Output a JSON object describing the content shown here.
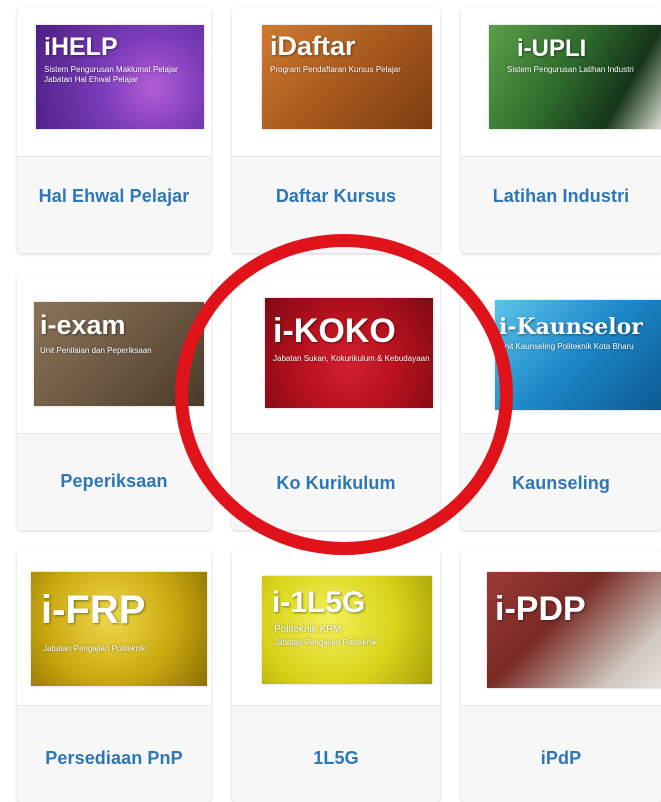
{
  "tiles": [
    {
      "label": "Hal Ehwal Pelajar",
      "banner_title": "iHELP",
      "banner_sub": "Sistem Pengurusan Maklumat Pelajar",
      "banner_sub2": "Jabatan Hal Ehwal Pelajar"
    },
    {
      "label": "Daftar Kursus",
      "banner_title": "iDaftar",
      "banner_sub": "Program Pendaftaran Kursus Pelajar",
      "banner_sub2": ""
    },
    {
      "label": "Latihan Industri",
      "banner_title": "i-UPLI",
      "banner_sub": "Sistem Pengurusan Latihan Industri",
      "banner_sub2": ""
    },
    {
      "label": "Peperiksaan",
      "banner_title": "i-exam",
      "banner_sub": "Unit Penilaian dan Peperiksaan",
      "banner_sub2": ""
    },
    {
      "label": "Ko Kurikulum",
      "banner_title": "i-KOKO",
      "banner_sub": "Jabatan Sukan, Kokurikulum & Kebudayaan",
      "banner_sub2": ""
    },
    {
      "label": "Kaunseling",
      "banner_title": "i-Kaunselor",
      "banner_sub": "Unit Kaunseling Politeknik Kota Bharu",
      "banner_sub2": ""
    },
    {
      "label": "Persediaan PnP",
      "banner_title": "i-FRP",
      "banner_sub": "Jabatan Pengajian Politeknik",
      "banner_sub2": ""
    },
    {
      "label": "1L5G",
      "banner_title": "i-1L5G",
      "banner_sub": "Politeknik KPM",
      "banner_sub2": "Jabatan Pengajian Politeknik"
    },
    {
      "label": "iPdP",
      "banner_title": "i-PDP",
      "banner_sub": "",
      "banner_sub2": ""
    }
  ],
  "colors": {
    "label_text": "#2d77b8",
    "highlight_circle": "#e0131a",
    "ihelp": "#6a2fa8",
    "idaftar": "#b8601c",
    "iupli": "#2e6a2c",
    "iexam": "#6e5a44",
    "ikoko": "#b8121e",
    "ikaunselor": "#1c87c8",
    "ifrp": "#c9a80e",
    "i1l5g": "#d8d21a",
    "ipdp": "#7a2a26"
  }
}
